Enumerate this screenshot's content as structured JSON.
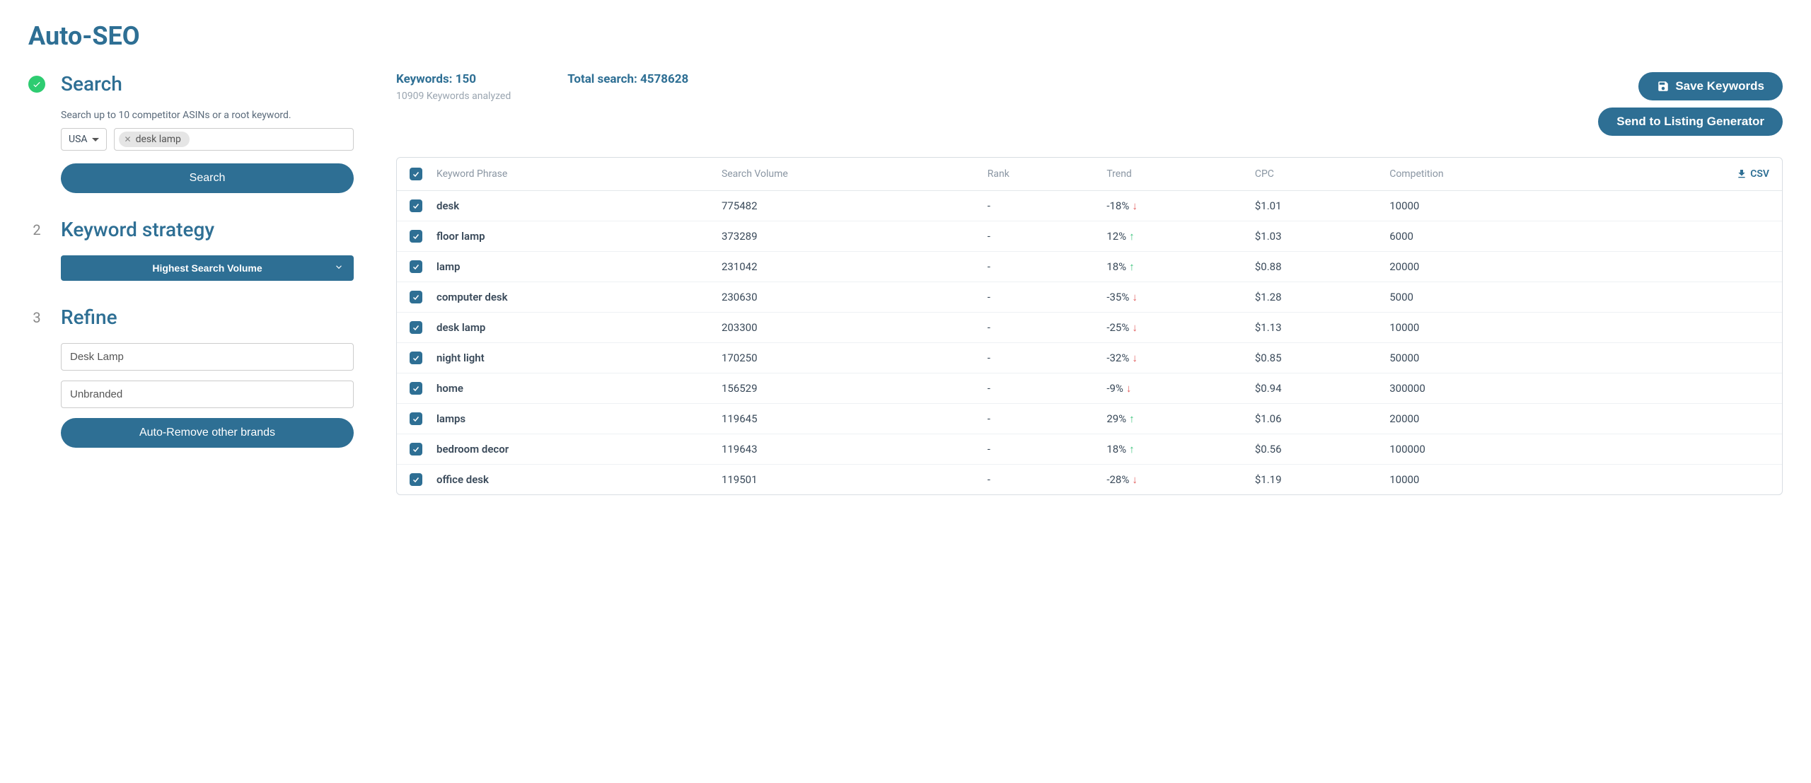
{
  "page_title": "Auto-SEO",
  "steps": {
    "search": {
      "title": "Search",
      "hint": "Search up to 10 competitor ASINs or a root keyword.",
      "country": "USA",
      "tag": "desk lamp",
      "button": "Search"
    },
    "strategy": {
      "number": "2",
      "title": "Keyword strategy",
      "selected": "Highest Search Volume"
    },
    "refine": {
      "number": "3",
      "title": "Refine",
      "input1": "Desk Lamp",
      "input2": "Unbranded",
      "button": "Auto-Remove other brands"
    }
  },
  "summary": {
    "keywords_label": "Keywords: ",
    "keywords_value": "150",
    "analyzed": "10909 Keywords analyzed",
    "total_search_label": "Total search: ",
    "total_search_value": "4578628",
    "save_btn": "Save Keywords",
    "send_btn": "Send to Listing Generator"
  },
  "table": {
    "headers": {
      "phrase": "Keyword Phrase",
      "volume": "Search Volume",
      "rank": "Rank",
      "trend": "Trend",
      "cpc": "CPC",
      "competition": "Competition",
      "csv": "CSV"
    },
    "rows": [
      {
        "phrase": "desk",
        "volume": "775482",
        "rank": "-",
        "trend": "-18%",
        "dir": "down",
        "cpc": "$1.01",
        "competition": "10000"
      },
      {
        "phrase": "floor lamp",
        "volume": "373289",
        "rank": "-",
        "trend": "12%",
        "dir": "up",
        "cpc": "$1.03",
        "competition": "6000"
      },
      {
        "phrase": "lamp",
        "volume": "231042",
        "rank": "-",
        "trend": "18%",
        "dir": "up",
        "cpc": "$0.88",
        "competition": "20000"
      },
      {
        "phrase": "computer desk",
        "volume": "230630",
        "rank": "-",
        "trend": "-35%",
        "dir": "down",
        "cpc": "$1.28",
        "competition": "5000"
      },
      {
        "phrase": "desk lamp",
        "volume": "203300",
        "rank": "-",
        "trend": "-25%",
        "dir": "down",
        "cpc": "$1.13",
        "competition": "10000"
      },
      {
        "phrase": "night light",
        "volume": "170250",
        "rank": "-",
        "trend": "-32%",
        "dir": "down",
        "cpc": "$0.85",
        "competition": "50000"
      },
      {
        "phrase": "home",
        "volume": "156529",
        "rank": "-",
        "trend": "-9%",
        "dir": "down",
        "cpc": "$0.94",
        "competition": "300000"
      },
      {
        "phrase": "lamps",
        "volume": "119645",
        "rank": "-",
        "trend": "29%",
        "dir": "up",
        "cpc": "$1.06",
        "competition": "20000"
      },
      {
        "phrase": "bedroom decor",
        "volume": "119643",
        "rank": "-",
        "trend": "18%",
        "dir": "up",
        "cpc": "$0.56",
        "competition": "100000"
      },
      {
        "phrase": "office desk",
        "volume": "119501",
        "rank": "-",
        "trend": "-28%",
        "dir": "down",
        "cpc": "$1.19",
        "competition": "10000"
      }
    ]
  }
}
